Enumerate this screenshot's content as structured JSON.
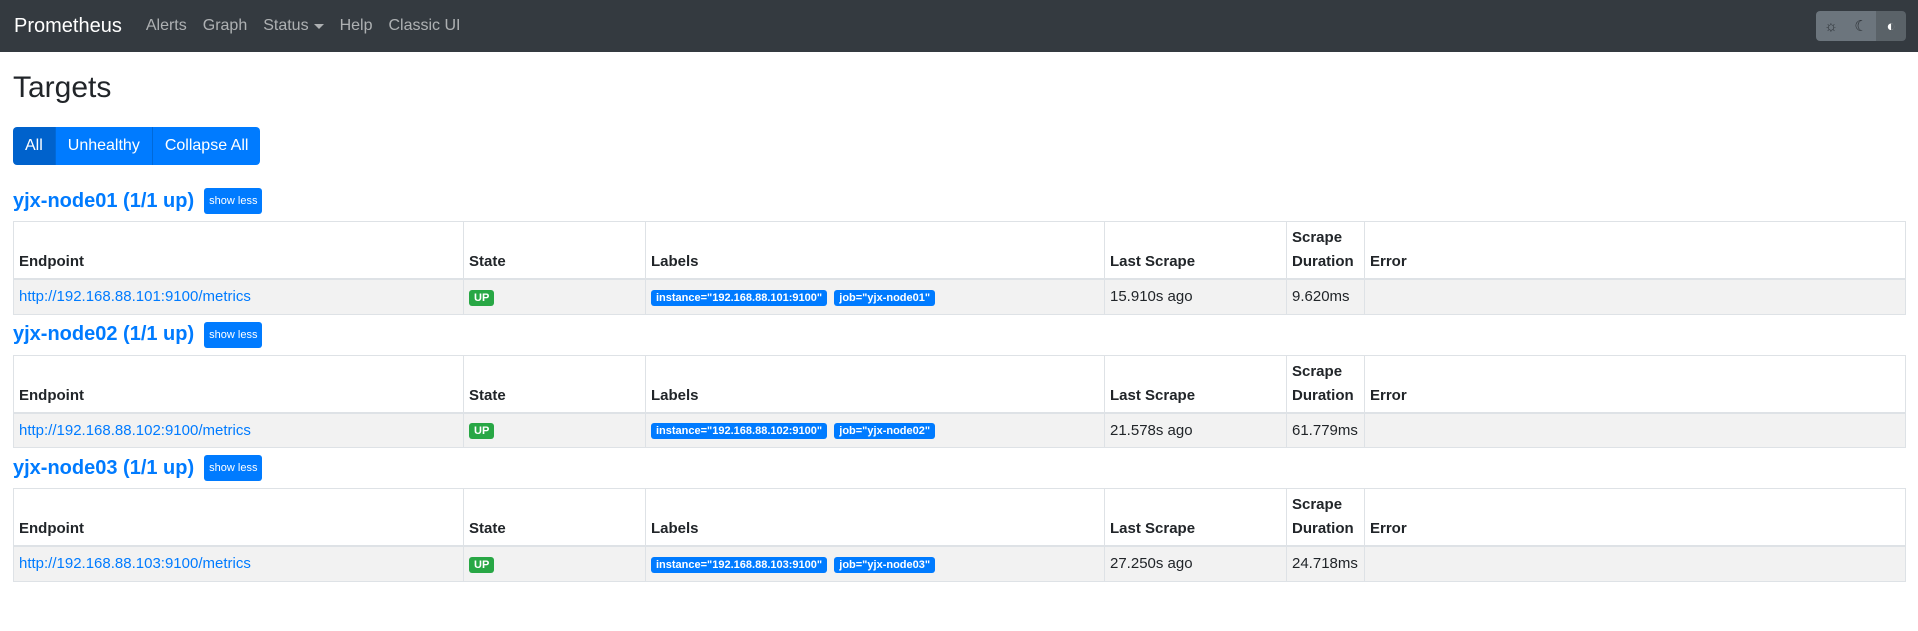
{
  "navbar": {
    "brand": "Prometheus",
    "items": [
      "Alerts",
      "Graph",
      "Status",
      "Help",
      "Classic UI"
    ],
    "theme_buttons": [
      "sun-icon",
      "moon-icon",
      "contrast-icon"
    ]
  },
  "page": {
    "title": "Targets",
    "filters": [
      "All",
      "Unhealthy",
      "Collapse All"
    ],
    "active_filter": "All"
  },
  "table_headers": {
    "endpoint": "Endpoint",
    "state": "State",
    "labels": "Labels",
    "last_scrape": "Last Scrape",
    "scrape_duration_line1": "Scrape",
    "scrape_duration_line2": "Duration",
    "error": "Error"
  },
  "pools": [
    {
      "title": "yjx-node01 (1/1 up)",
      "toggle": "show less",
      "target": {
        "endpoint": "http://192.168.88.101:9100/metrics",
        "state": "UP",
        "labels": [
          "instance=\"192.168.88.101:9100\"",
          "job=\"yjx-node01\""
        ],
        "last_scrape": "15.910s ago",
        "duration": "9.620ms",
        "error": ""
      }
    },
    {
      "title": "yjx-node02 (1/1 up)",
      "toggle": "show less",
      "target": {
        "endpoint": "http://192.168.88.102:9100/metrics",
        "state": "UP",
        "labels": [
          "instance=\"192.168.88.102:9100\"",
          "job=\"yjx-node02\""
        ],
        "last_scrape": "21.578s ago",
        "duration": "61.779ms",
        "error": ""
      }
    },
    {
      "title": "yjx-node03 (1/1 up)",
      "toggle": "show less",
      "target": {
        "endpoint": "http://192.168.88.103:9100/metrics",
        "state": "UP",
        "labels": [
          "instance=\"192.168.88.103:9100\"",
          "job=\"yjx-node03\""
        ],
        "last_scrape": "27.250s ago",
        "duration": "24.718ms",
        "error": ""
      }
    }
  ],
  "colors": {
    "navbar_bg": "#343a40",
    "link": "#007bff",
    "state_up": "#28a745"
  }
}
